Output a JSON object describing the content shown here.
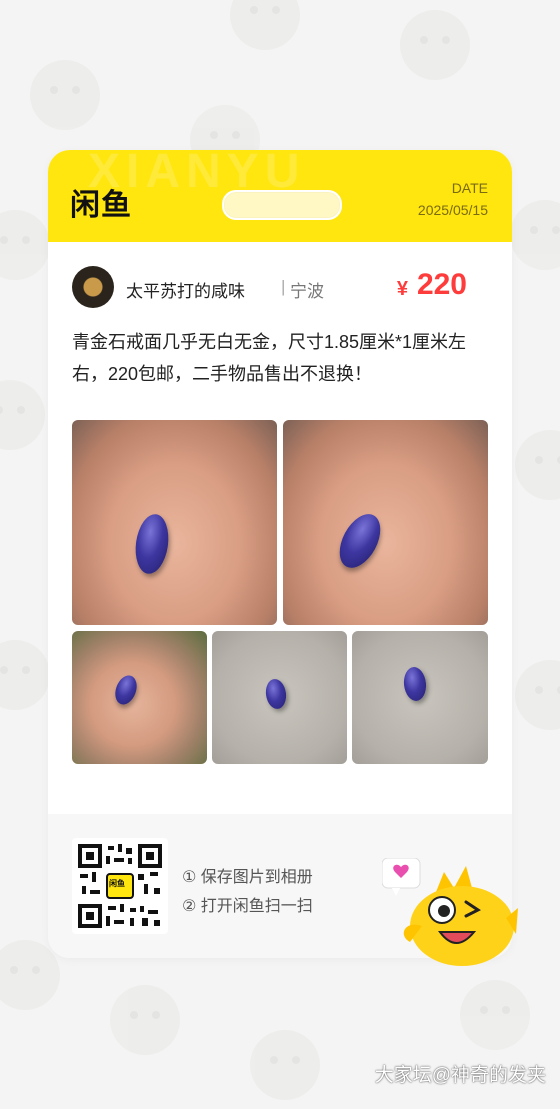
{
  "header": {
    "logo": "闲鱼",
    "date_label": "DATE",
    "date_value": "2025/05/15"
  },
  "seller": {
    "name": "太平苏打的咸味",
    "separator": "|",
    "city": "宁波",
    "avatar": "seller-avatar"
  },
  "price": {
    "symbol": "¥",
    "value": "220"
  },
  "description": "青金石戒面几乎无白无金，尺寸1.85厘米*1厘米左右，220包邮，二手物品售出不退换！",
  "photos": [
    {
      "id": "photo-1",
      "content": "blue stone on palm"
    },
    {
      "id": "photo-2",
      "content": "blue stone on palm"
    },
    {
      "id": "photo-3",
      "content": "blue stone on palm"
    },
    {
      "id": "photo-4",
      "content": "blue stone on table"
    },
    {
      "id": "photo-5",
      "content": "blue stone on table"
    }
  ],
  "footer": {
    "qr_label": "闲鱼",
    "step1": "① 保存图片到相册",
    "step2": "② 打开闲鱼扫一扫"
  },
  "watermark": "大家坛@神奇的发夹",
  "colors": {
    "brand_yellow": "#ffe60f",
    "price_red": "#ff3c3c",
    "stone_blue": "#3d36a0"
  }
}
